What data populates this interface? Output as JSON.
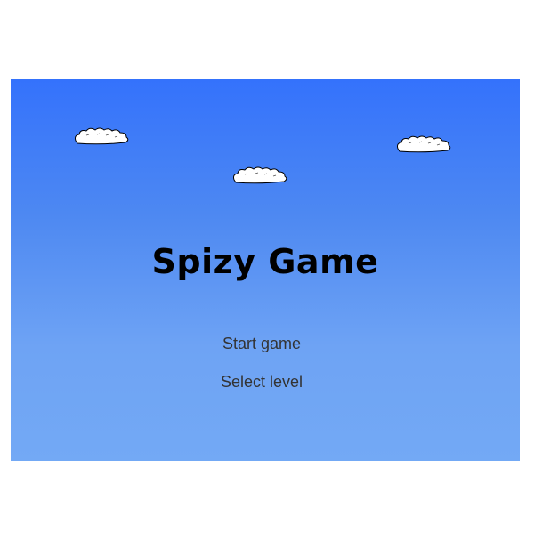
{
  "game": {
    "title": "Spizy Game",
    "menu": {
      "start_label": "Start game",
      "select_level_label": "Select level"
    }
  },
  "colors": {
    "sky_top": "#3472fc",
    "sky_bottom": "#73a9f5",
    "cloud": "#ffffff",
    "title_text": "#000000",
    "menu_text": "#333333"
  }
}
